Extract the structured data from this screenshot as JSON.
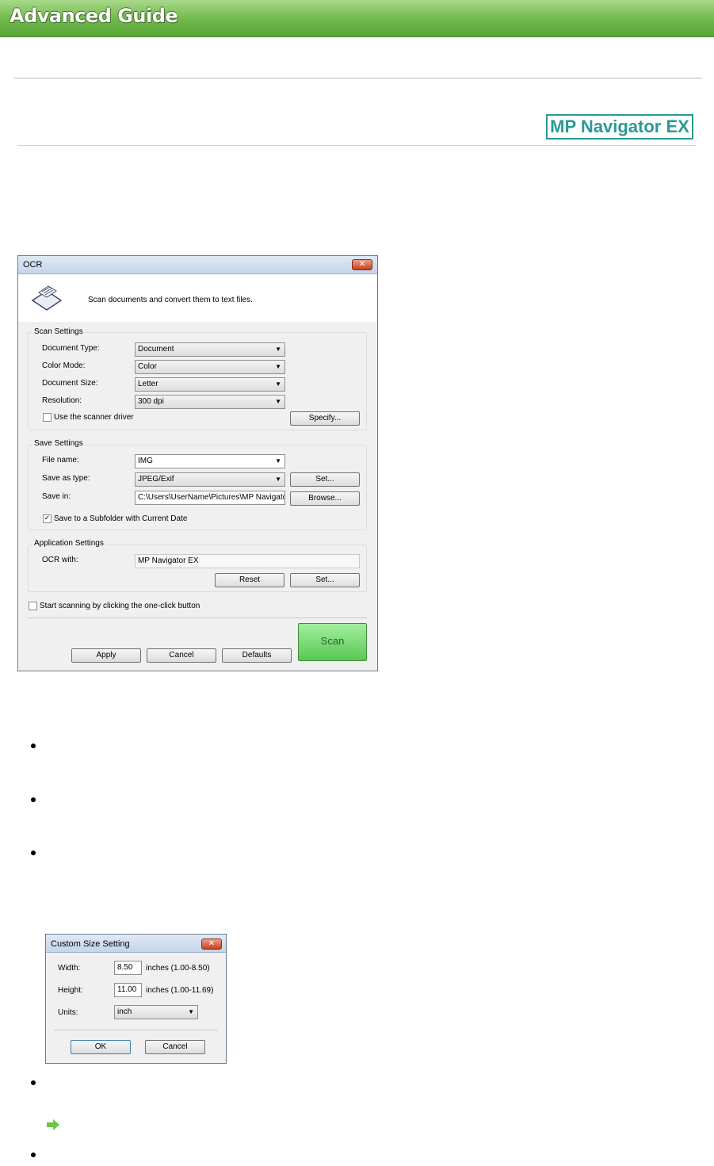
{
  "header": {
    "title": "Advanced Guide",
    "product_badge": "MP Navigator EX"
  },
  "ocr_dialog": {
    "title": "OCR",
    "close_icon": "close-x-icon",
    "description": "Scan documents and convert them to text files.",
    "scan_settings": {
      "group_title": "Scan Settings",
      "document_type_label": "Document Type:",
      "document_type_value": "Document",
      "color_mode_label": "Color Mode:",
      "color_mode_value": "Color",
      "document_size_label": "Document Size:",
      "document_size_value": "Letter",
      "resolution_label": "Resolution:",
      "resolution_value": "300 dpi",
      "use_scanner_driver_label": "Use the scanner driver",
      "use_scanner_driver_checked": false,
      "specify_button": "Specify..."
    },
    "save_settings": {
      "group_title": "Save Settings",
      "file_name_label": "File name:",
      "file_name_value": "IMG",
      "save_as_type_label": "Save as type:",
      "save_as_type_value": "JPEG/Exif",
      "set_button": "Set...",
      "save_in_label": "Save in:",
      "save_in_value": "C:\\Users\\UserName\\Pictures\\MP Navigator",
      "browse_button": "Browse...",
      "subfolder_label": "Save to a Subfolder with Current Date",
      "subfolder_checked": true
    },
    "application_settings": {
      "group_title": "Application Settings",
      "ocr_with_label": "OCR with:",
      "ocr_with_value": "MP Navigator EX",
      "reset_button": "Reset",
      "set_button": "Set..."
    },
    "one_click_label": "Start scanning by clicking the one-click button",
    "one_click_checked": false,
    "apply_button": "Apply",
    "cancel_button": "Cancel",
    "defaults_button": "Defaults",
    "scan_button": "Scan"
  },
  "custom_size_dialog": {
    "title": "Custom Size Setting",
    "width_label": "Width:",
    "width_value": "8.50",
    "width_range": "inches (1.00-8.50)",
    "height_label": "Height:",
    "height_value": "11.00",
    "height_range": "inches (1.00-11.69)",
    "units_label": "Units:",
    "units_value": "inch",
    "ok_button": "OK",
    "cancel_button": "Cancel"
  },
  "colors": {
    "banner_green": "#6fb84a",
    "badge_teal": "#2a9a96",
    "scan_green": "#59c853",
    "link_arrow_green": "#6cc644"
  }
}
